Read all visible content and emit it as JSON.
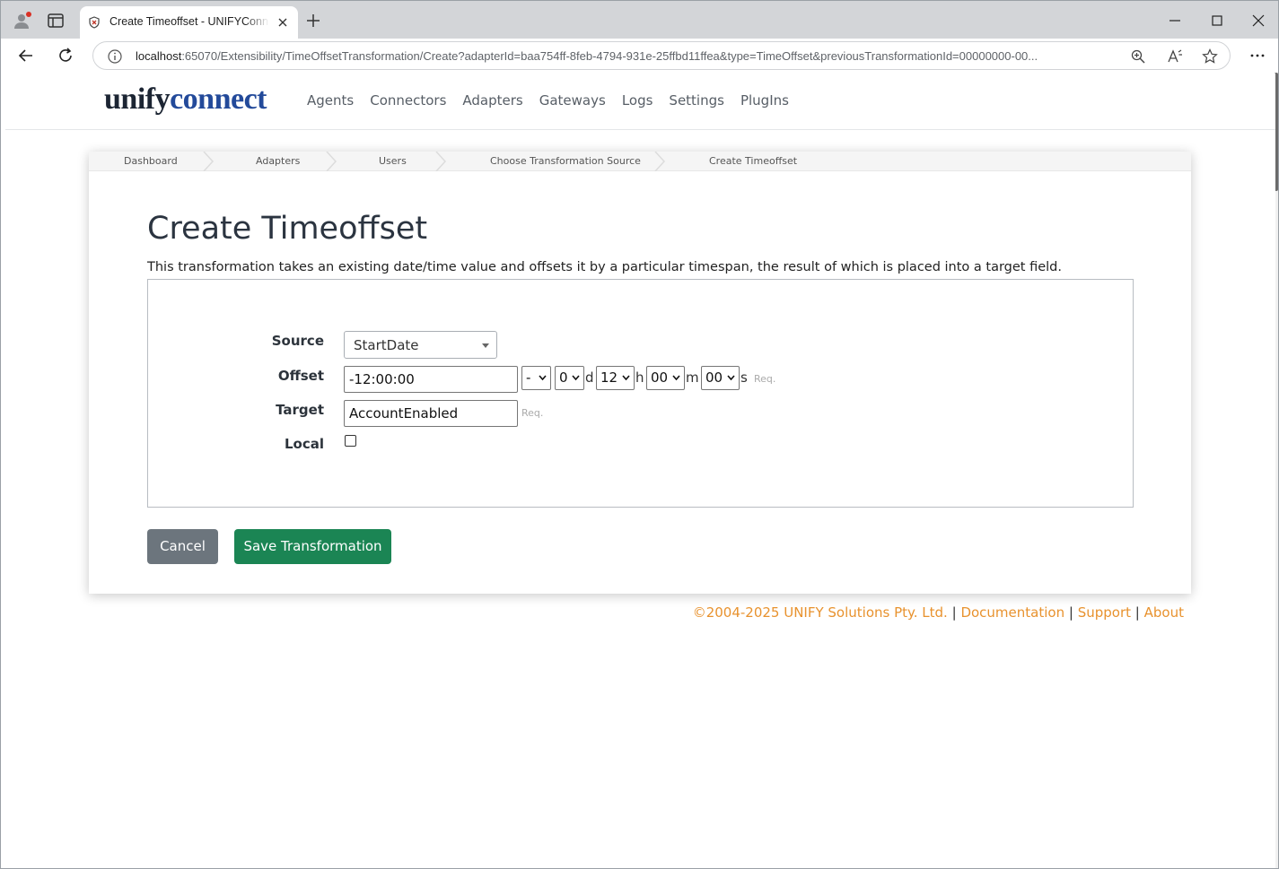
{
  "browser": {
    "tab_title": "Create Timeoffset - UNIFYConnect",
    "url_host": "localhost",
    "url_rest": ":65070/Extensibility/TimeOffsetTransformation/Create?adapterId=baa754ff-8feb-4794-931e-25ffbd11ffea&type=TimeOffset&previousTransformationId=00000000-00..."
  },
  "site": {
    "logo_part1": "unify",
    "logo_part2": "connect",
    "nav": [
      "Agents",
      "Connectors",
      "Adapters",
      "Gateways",
      "Logs",
      "Settings",
      "PlugIns"
    ]
  },
  "breadcrumb": [
    "Dashboard",
    "Adapters",
    "Users",
    "Choose Transformation Source",
    "Create Timeoffset"
  ],
  "page": {
    "title": "Create Timeoffset",
    "description": "This transformation takes an existing date/time value and offsets it by a particular timespan, the result of which is placed into a target field."
  },
  "form": {
    "source_label": "Source",
    "source_value": "StartDate",
    "offset_label": "Offset",
    "offset_value": "-12:00:00",
    "sign_value": "-",
    "days_value": "0",
    "days_unit": "d",
    "hours_value": "12",
    "hours_unit": "h",
    "minutes_value": "00",
    "minutes_unit": "m",
    "seconds_value": "00",
    "seconds_unit": "s",
    "required": "Req.",
    "target_label": "Target",
    "target_value": "AccountEnabled",
    "local_label": "Local",
    "local_checked": false
  },
  "actions": {
    "cancel": "Cancel",
    "save": "Save Transformation"
  },
  "footer": {
    "copyright": "©2004-2025 UNIFY Solutions Pty. Ltd.",
    "sep": "|",
    "documentation": "Documentation",
    "support": "Support",
    "about": "About"
  },
  "colors": {
    "brand_dark": "#1c2533",
    "brand_blue": "#234a9a",
    "save_button": "#1b8554",
    "cancel_button": "#6c757d",
    "footer_link": "#e8922e"
  }
}
